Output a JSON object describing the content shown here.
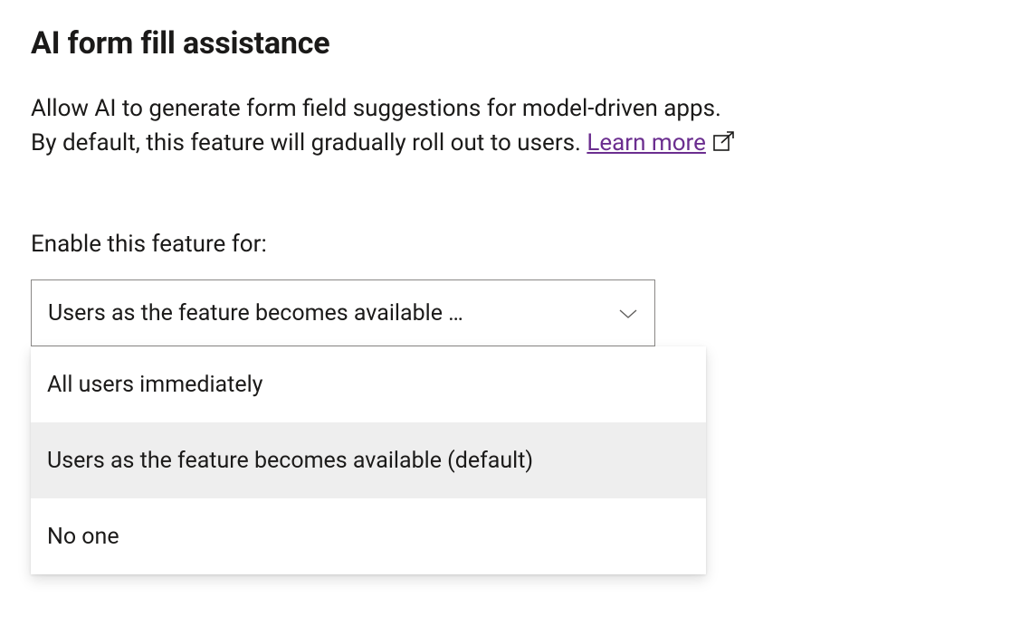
{
  "section": {
    "title": "AI form fill assistance",
    "description_line1": "Allow AI to generate form field suggestions for model-driven apps.",
    "description_line2_prefix": "By default, this feature will gradually roll out to users. ",
    "learn_more_label": "Learn more"
  },
  "field": {
    "label": "Enable this feature for:",
    "selected_display": "Users as the feature becomes available …",
    "options": [
      {
        "label": "All users immediately",
        "selected": false
      },
      {
        "label": "Users as the feature becomes available (default)",
        "selected": true
      },
      {
        "label": "No one",
        "selected": false
      }
    ]
  },
  "colors": {
    "link": "#6b2e8f",
    "border": "#8a8886",
    "option_selected_bg": "#eeeeee"
  }
}
